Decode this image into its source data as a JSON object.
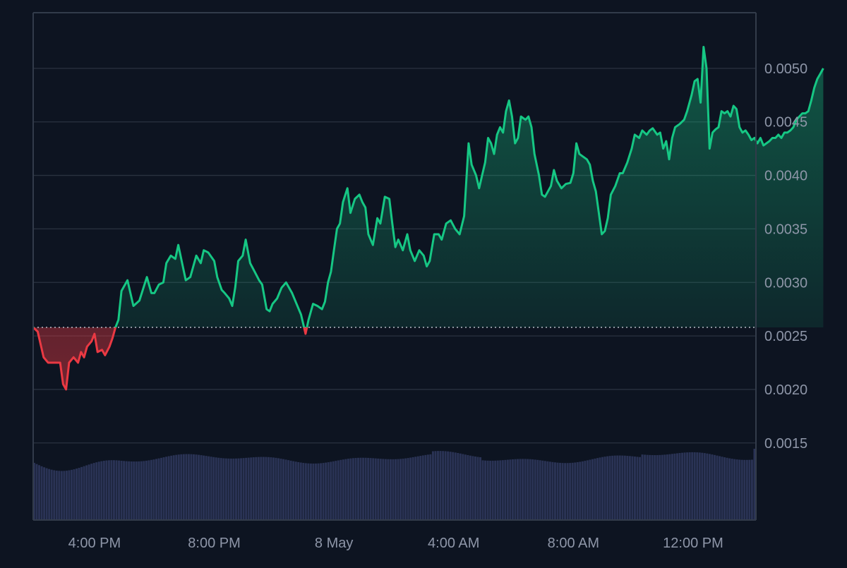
{
  "colors": {
    "background": "#0d1421",
    "grid": "#2a3240",
    "frame": "#323b4a",
    "up": "#16c784",
    "down": "#ea3943",
    "baseline": "#c7ccd6",
    "volume": "#2a3355",
    "axis_text": "#8e96a8"
  },
  "chart_data": {
    "type": "line",
    "title": "",
    "xlabel": "",
    "ylabel": "",
    "y_range": [
      0.00078,
      0.00552
    ],
    "baseline_value": 0.00258,
    "y_ticks": [
      "0.0015",
      "0.0020",
      "0.0025",
      "0.0030",
      "0.0035",
      "0.0040",
      "0.0045",
      "0.0050"
    ],
    "x_ticks": [
      "4:00 PM",
      "8:00 PM",
      "8 May",
      "4:00 AM",
      "8:00 AM",
      "12:00 PM"
    ],
    "x_tick_hours": [
      16,
      20,
      24,
      28,
      32,
      36
    ],
    "x_domain_hours": [
      13.95,
      38.1
    ],
    "grid": true,
    "series": [
      {
        "values": [
          [
            13.95,
            0.00258
          ],
          [
            14.1,
            0.00254
          ],
          [
            14.3,
            0.0023
          ],
          [
            14.45,
            0.00225
          ],
          [
            14.8,
            0.00225
          ],
          [
            14.85,
            0.00225
          ],
          [
            14.95,
            0.00205
          ],
          [
            15.05,
            0.002
          ],
          [
            15.15,
            0.00225
          ],
          [
            15.3,
            0.0023
          ],
          [
            15.45,
            0.00225
          ],
          [
            15.55,
            0.00235
          ],
          [
            15.65,
            0.0023
          ],
          [
            15.75,
            0.0024
          ],
          [
            15.9,
            0.00245
          ],
          [
            16.0,
            0.00252
          ],
          [
            16.1,
            0.00235
          ],
          [
            16.25,
            0.00237
          ],
          [
            16.35,
            0.00232
          ],
          [
            16.5,
            0.0024
          ],
          [
            16.6,
            0.00248
          ],
          [
            16.7,
            0.00258
          ],
          [
            16.8,
            0.00265
          ],
          [
            16.9,
            0.00292
          ],
          [
            17.1,
            0.00302
          ],
          [
            17.2,
            0.0029
          ],
          [
            17.3,
            0.00278
          ],
          [
            17.5,
            0.00283
          ],
          [
            17.6,
            0.00292
          ],
          [
            17.75,
            0.00305
          ],
          [
            17.9,
            0.0029
          ],
          [
            18.0,
            0.0029
          ],
          [
            18.15,
            0.00298
          ],
          [
            18.3,
            0.003
          ],
          [
            18.4,
            0.00318
          ],
          [
            18.55,
            0.00325
          ],
          [
            18.7,
            0.00322
          ],
          [
            18.8,
            0.00335
          ],
          [
            18.95,
            0.00315
          ],
          [
            19.05,
            0.00302
          ],
          [
            19.2,
            0.00305
          ],
          [
            19.4,
            0.00325
          ],
          [
            19.55,
            0.00318
          ],
          [
            19.65,
            0.0033
          ],
          [
            19.8,
            0.00328
          ],
          [
            20.0,
            0.0032
          ],
          [
            20.1,
            0.00305
          ],
          [
            20.25,
            0.00293
          ],
          [
            20.35,
            0.0029
          ],
          [
            20.5,
            0.00285
          ],
          [
            20.6,
            0.00278
          ],
          [
            20.7,
            0.00295
          ],
          [
            20.8,
            0.0032
          ],
          [
            20.95,
            0.00325
          ],
          [
            21.05,
            0.0034
          ],
          [
            21.2,
            0.00318
          ],
          [
            21.35,
            0.0031
          ],
          [
            21.5,
            0.00302
          ],
          [
            21.6,
            0.00298
          ],
          [
            21.75,
            0.00275
          ],
          [
            21.85,
            0.00273
          ],
          [
            21.95,
            0.0028
          ],
          [
            22.1,
            0.00285
          ],
          [
            22.25,
            0.00295
          ],
          [
            22.4,
            0.003
          ],
          [
            22.6,
            0.0029
          ],
          [
            22.75,
            0.0028
          ],
          [
            22.9,
            0.0027
          ],
          [
            23.05,
            0.00252
          ],
          [
            23.15,
            0.00265
          ],
          [
            23.3,
            0.0028
          ],
          [
            23.45,
            0.00278
          ],
          [
            23.6,
            0.00275
          ],
          [
            23.7,
            0.00282
          ],
          [
            23.8,
            0.003
          ],
          [
            23.9,
            0.0031
          ],
          [
            24.0,
            0.0033
          ],
          [
            24.1,
            0.0035
          ],
          [
            24.2,
            0.00355
          ],
          [
            24.3,
            0.00375
          ],
          [
            24.45,
            0.00388
          ],
          [
            24.55,
            0.00365
          ],
          [
            24.7,
            0.00378
          ],
          [
            24.85,
            0.00382
          ],
          [
            24.95,
            0.00375
          ],
          [
            25.05,
            0.0037
          ],
          [
            25.15,
            0.00345
          ],
          [
            25.3,
            0.00335
          ],
          [
            25.45,
            0.0036
          ],
          [
            25.55,
            0.00355
          ],
          [
            25.7,
            0.0038
          ],
          [
            25.85,
            0.00378
          ],
          [
            25.95,
            0.00355
          ],
          [
            26.05,
            0.00333
          ],
          [
            26.15,
            0.0034
          ],
          [
            26.3,
            0.0033
          ],
          [
            26.45,
            0.00345
          ],
          [
            26.55,
            0.0033
          ],
          [
            26.7,
            0.0032
          ],
          [
            26.85,
            0.0033
          ],
          [
            27.0,
            0.00325
          ],
          [
            27.1,
            0.00315
          ],
          [
            27.2,
            0.0032
          ],
          [
            27.35,
            0.00345
          ],
          [
            27.5,
            0.00345
          ],
          [
            27.6,
            0.0034
          ],
          [
            27.75,
            0.00355
          ],
          [
            27.9,
            0.00358
          ],
          [
            28.05,
            0.0035
          ],
          [
            28.2,
            0.00345
          ],
          [
            28.35,
            0.00362
          ],
          [
            28.5,
            0.0043
          ],
          [
            28.6,
            0.0041
          ],
          [
            28.75,
            0.004
          ],
          [
            28.85,
            0.00388
          ],
          [
            28.95,
            0.004
          ],
          [
            29.05,
            0.00412
          ],
          [
            29.15,
            0.00435
          ],
          [
            29.25,
            0.0043
          ],
          [
            29.35,
            0.0042
          ],
          [
            29.45,
            0.00438
          ],
          [
            29.55,
            0.00445
          ],
          [
            29.65,
            0.0044
          ],
          [
            29.75,
            0.0046
          ],
          [
            29.85,
            0.0047
          ],
          [
            29.95,
            0.00455
          ],
          [
            30.05,
            0.0043
          ],
          [
            30.15,
            0.00435
          ],
          [
            30.25,
            0.00455
          ],
          [
            30.4,
            0.00452
          ],
          [
            30.5,
            0.00455
          ],
          [
            30.6,
            0.00445
          ],
          [
            30.7,
            0.0042
          ],
          [
            30.85,
            0.004
          ],
          [
            30.95,
            0.00382
          ],
          [
            31.05,
            0.0038
          ],
          [
            31.15,
            0.00385
          ],
          [
            31.25,
            0.0039
          ],
          [
            31.35,
            0.00405
          ],
          [
            31.45,
            0.00395
          ],
          [
            31.6,
            0.00388
          ],
          [
            31.75,
            0.00392
          ],
          [
            31.9,
            0.00393
          ],
          [
            32.0,
            0.00402
          ],
          [
            32.1,
            0.0043
          ],
          [
            32.2,
            0.0042
          ],
          [
            32.3,
            0.00418
          ],
          [
            32.45,
            0.00415
          ],
          [
            32.55,
            0.0041
          ],
          [
            32.65,
            0.00395
          ],
          [
            32.75,
            0.00385
          ],
          [
            32.85,
            0.00365
          ],
          [
            32.95,
            0.00345
          ],
          [
            33.05,
            0.00348
          ],
          [
            33.15,
            0.0036
          ],
          [
            33.25,
            0.00382
          ],
          [
            33.4,
            0.0039
          ],
          [
            33.55,
            0.00402
          ],
          [
            33.65,
            0.00402
          ],
          [
            33.8,
            0.00412
          ],
          [
            33.95,
            0.00425
          ],
          [
            34.05,
            0.00438
          ],
          [
            34.2,
            0.00435
          ],
          [
            34.3,
            0.00442
          ],
          [
            34.45,
            0.00438
          ],
          [
            34.55,
            0.00442
          ],
          [
            34.65,
            0.00444
          ],
          [
            34.8,
            0.00438
          ],
          [
            34.9,
            0.0044
          ],
          [
            35.0,
            0.00425
          ],
          [
            35.1,
            0.00432
          ],
          [
            35.2,
            0.00415
          ],
          [
            35.3,
            0.00435
          ],
          [
            35.4,
            0.00445
          ],
          [
            35.55,
            0.00448
          ],
          [
            35.7,
            0.00452
          ],
          [
            35.8,
            0.0046
          ],
          [
            35.95,
            0.00475
          ],
          [
            36.05,
            0.00488
          ],
          [
            36.15,
            0.0049
          ],
          [
            36.25,
            0.00468
          ],
          [
            36.35,
            0.0052
          ],
          [
            36.45,
            0.005
          ],
          [
            36.55,
            0.00425
          ],
          [
            36.65,
            0.0044
          ],
          [
            36.75,
            0.00443
          ],
          [
            36.85,
            0.00445
          ],
          [
            36.95,
            0.0046
          ],
          [
            37.05,
            0.00458
          ],
          [
            37.15,
            0.0046
          ],
          [
            37.25,
            0.00455
          ],
          [
            37.35,
            0.00465
          ],
          [
            37.45,
            0.00462
          ],
          [
            37.55,
            0.00445
          ],
          [
            37.65,
            0.0044
          ],
          [
            37.75,
            0.00442
          ],
          [
            37.85,
            0.00438
          ],
          [
            37.95,
            0.00433
          ],
          [
            38.05,
            0.00435
          ],
          [
            38.15,
            0.0043
          ],
          [
            38.25,
            0.00435
          ],
          [
            38.35,
            0.00428
          ],
          [
            38.45,
            0.0043
          ],
          [
            38.55,
            0.00432
          ],
          [
            38.65,
            0.00435
          ],
          [
            38.75,
            0.00435
          ],
          [
            38.85,
            0.00438
          ],
          [
            38.95,
            0.00435
          ],
          [
            39.05,
            0.0044
          ],
          [
            39.15,
            0.0044
          ],
          [
            39.25,
            0.00442
          ],
          [
            39.35,
            0.00445
          ],
          [
            39.45,
            0.00452
          ],
          [
            39.55,
            0.00455
          ],
          [
            39.65,
            0.00458
          ],
          [
            39.75,
            0.00458
          ],
          [
            39.85,
            0.0046
          ],
          [
            39.95,
            0.0047
          ],
          [
            40.05,
            0.00482
          ],
          [
            40.15,
            0.0049
          ],
          [
            40.25,
            0.00495
          ],
          [
            40.35,
            0.005
          ]
        ]
      }
    ]
  }
}
